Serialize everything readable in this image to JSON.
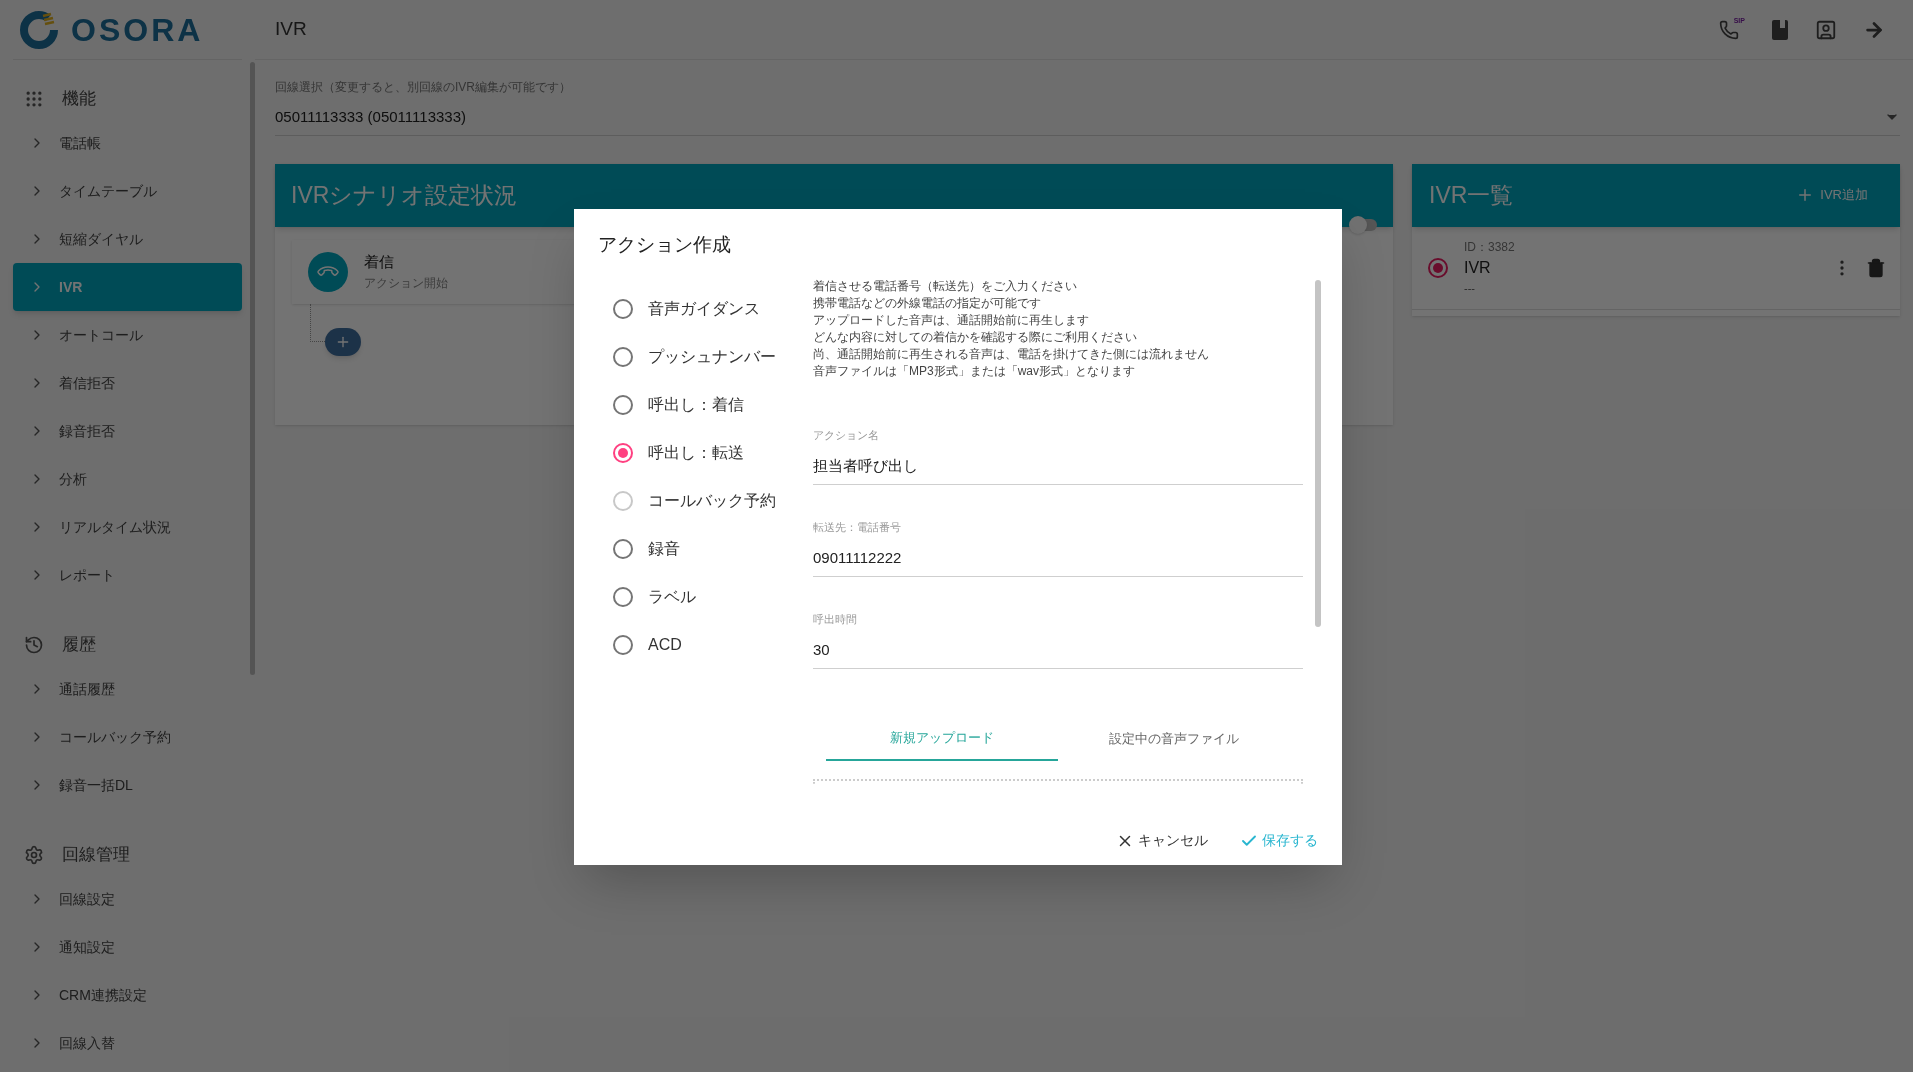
{
  "app": {
    "logo": "OSORA",
    "page_title": "IVR",
    "sip_badge": "SIP"
  },
  "sidebar": {
    "sections": [
      {
        "title": "機能",
        "kind": "grid",
        "items": [
          {
            "label": "電話帳",
            "selected": false
          },
          {
            "label": "タイムテーブル",
            "selected": false
          },
          {
            "label": "短縮ダイヤル",
            "selected": false
          },
          {
            "label": "IVR",
            "selected": true
          },
          {
            "label": "オートコール",
            "selected": false
          },
          {
            "label": "着信拒否",
            "selected": false
          },
          {
            "label": "録音拒否",
            "selected": false
          },
          {
            "label": "分析",
            "selected": false
          },
          {
            "label": "リアルタイム状況",
            "selected": false
          },
          {
            "label": "レポート",
            "selected": false
          }
        ]
      },
      {
        "title": "履歴",
        "kind": "history",
        "items": [
          {
            "label": "通話履歴",
            "selected": false
          },
          {
            "label": "コールバック予約",
            "selected": false
          },
          {
            "label": "録音一括DL",
            "selected": false
          }
        ]
      },
      {
        "title": "回線管理",
        "kind": "gear",
        "items": [
          {
            "label": "回線設定",
            "selected": false
          },
          {
            "label": "通知設定",
            "selected": false
          },
          {
            "label": "CRM連携設定",
            "selected": false
          },
          {
            "label": "回線入替",
            "selected": false
          }
        ]
      }
    ]
  },
  "line_select": {
    "label": "回線選択（変更すると、別回線のIVR編集が可能です）",
    "value": "05011113333 (05011113333)"
  },
  "scenario": {
    "title": "IVRシナリオ設定状況",
    "toggle_on": false,
    "start_node": {
      "title": "着信",
      "subtitle": "アクション開始"
    }
  },
  "ivr_list": {
    "title": "IVR一覧",
    "add_label": "IVR追加",
    "items": [
      {
        "id": "ID：3382",
        "name": "IVR",
        "description": "---",
        "selected": true
      }
    ]
  },
  "dialog": {
    "title": "アクション作成",
    "options": [
      {
        "label": "音声ガイダンス",
        "selected": false,
        "disabled": false
      },
      {
        "label": "プッシュナンバー",
        "selected": false,
        "disabled": false
      },
      {
        "label": "呼出し：着信",
        "selected": false,
        "disabled": false
      },
      {
        "label": "呼出し：転送",
        "selected": true,
        "disabled": false
      },
      {
        "label": "コールバック予約",
        "selected": false,
        "disabled": true
      },
      {
        "label": "録音",
        "selected": false,
        "disabled": false
      },
      {
        "label": "ラベル",
        "selected": false,
        "disabled": false
      },
      {
        "label": "ACD",
        "selected": false,
        "disabled": false
      }
    ],
    "description": [
      "着信させる電話番号（転送先）をご入力ください",
      "携帯電話などの外線電話の指定が可能です",
      "アップロードした音声は、通話開始前に再生します",
      "どんな内容に対しての着信かを確認する際にご利用ください",
      "尚、通話開始前に再生される音声は、電話を掛けてきた側には流れません",
      "音声ファイルは「MP3形式」または「wav形式」となります"
    ],
    "fields": [
      {
        "label": "アクション名",
        "value": "担当者呼び出し"
      },
      {
        "label": "転送先：電話番号",
        "value": "09011112222"
      },
      {
        "label": "呼出時間",
        "value": "30"
      }
    ],
    "tabs": [
      {
        "label": "新規アップロード",
        "selected": true
      },
      {
        "label": "設定中の音声ファイル",
        "selected": false
      }
    ],
    "buttons": [
      {
        "label": "キャンセル",
        "kind": "cancel"
      },
      {
        "label": "保存する",
        "kind": "save"
      }
    ]
  }
}
